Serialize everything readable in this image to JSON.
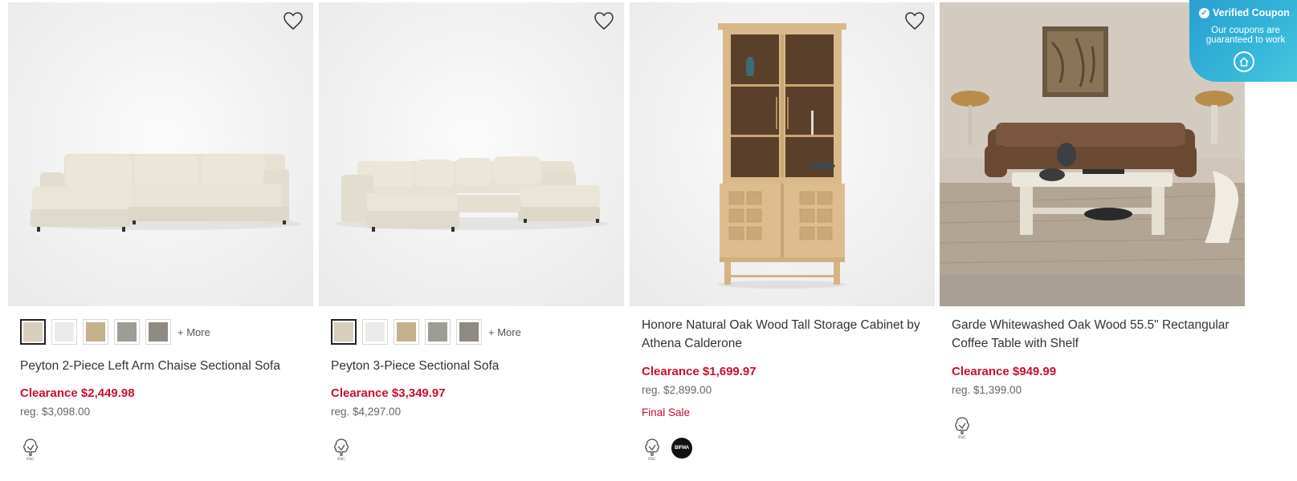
{
  "products": [
    {
      "name": "Peyton 2-Piece Left Arm Chaise Sectional Sofa",
      "clearance": "Clearance $2,449.98",
      "regular": "reg. $3,098.00",
      "swatch_colors": [
        "#d9cdbb",
        "#ebebea",
        "#c4b08d",
        "#9c9d94",
        "#8f8a82"
      ],
      "more_label": "+ More",
      "certifications": [
        "FSC"
      ]
    },
    {
      "name": "Peyton 3-Piece Sectional Sofa",
      "clearance": "Clearance $3,349.97",
      "regular": "reg. $4,297.00",
      "swatch_colors": [
        "#d9cdbb",
        "#ebebea",
        "#c4b08d",
        "#9c9d94",
        "#8f8a82"
      ],
      "more_label": "+ More",
      "certifications": [
        "FSC"
      ]
    },
    {
      "name": "Honore Natural Oak Wood Tall Storage Cabinet by Athena Calderone",
      "clearance": "Clearance $1,699.97",
      "regular": "reg. $2,899.00",
      "final_sale": "Final Sale",
      "certifications": [
        "FSC",
        "BIFMA"
      ]
    },
    {
      "name": "Garde Whitewashed Oak Wood 55.5\" Rectangular Coffee Table with Shelf",
      "clearance": "Clearance $949.99",
      "regular": "reg. $1,399.00",
      "certifications": [
        "FSC"
      ]
    }
  ],
  "coupon_badge": {
    "title": "Verified Coupon",
    "subtitle": "Our coupons are guaranteed to work"
  },
  "icons": {
    "favorite": "heart-outline-icon",
    "certification": "fsc-tree-icon",
    "coupon_check": "check-circle-icon",
    "coupon_home": "home-icon"
  },
  "colors": {
    "clearance": "#c8102e",
    "coupon_bg": "#35b6d9"
  }
}
